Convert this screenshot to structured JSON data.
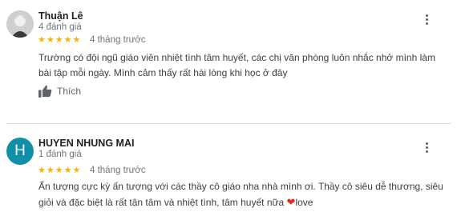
{
  "reviews": [
    {
      "name": "Thuận Lê",
      "review_count": "4 đánh giá",
      "stars": "★★★★★",
      "rating": 5,
      "time": "4 tháng trước",
      "text": "Trường có đội ngũ giáo viên nhiệt tình tâm huyết, các chị văn phòng luôn nhắc nhở mình làm bài tập mỗi ngày. Mình cảm thấy rất hài lòng khi học ở đây",
      "like_label": "Thích"
    },
    {
      "name": "HUYEN NHUNG MAI",
      "avatar_letter": "H",
      "avatar_color": "#0f8fa8",
      "review_count": "1 đánh giá",
      "stars": "★★★★★",
      "rating": 5,
      "time": "4 tháng trước",
      "text_main": "Ấn tượng cực kỳ ấn tượng với các thầy cô giáo nha nhà mình ơi. Thầy cô siêu dễ thương, siêu giỏi và đặc biệt là rất tận tâm và nhiệt tình, tâm huyết nữa ",
      "heart": "❤",
      "text_end": "love"
    }
  ],
  "colors": {
    "star": "#f5b400",
    "divider": "#dadce0",
    "secondary_text": "#70757a"
  }
}
